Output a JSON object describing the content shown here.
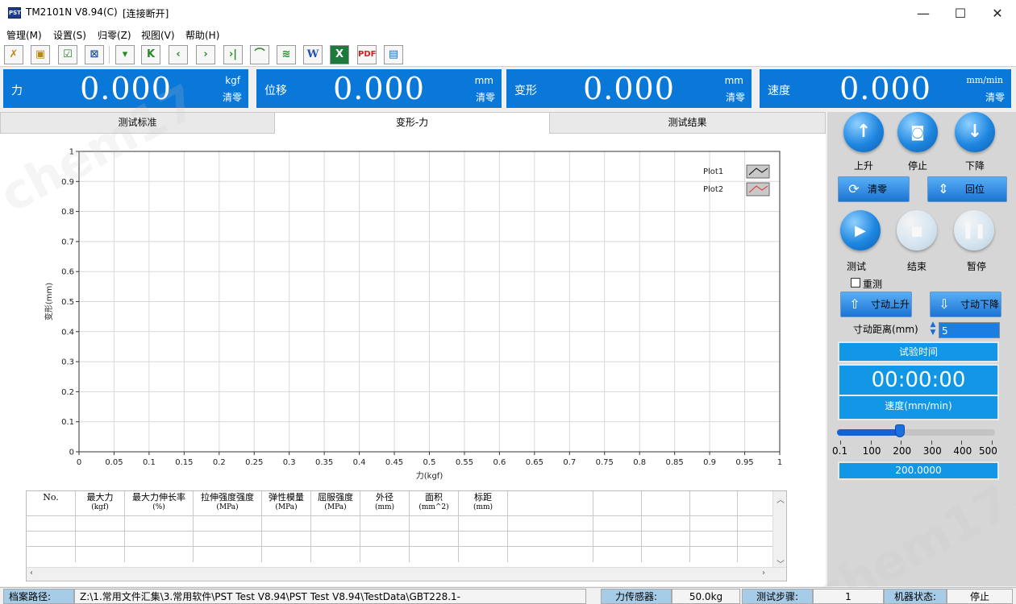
{
  "window": {
    "title": "TM2101N V8.94(C)",
    "status": "[连接断开]",
    "minimize": "—",
    "maximize": "☐",
    "close": "✕",
    "icon_text": "PST"
  },
  "menu": [
    "管理(M)",
    "设置(S)",
    "归零(Z)",
    "视图(V)",
    "帮助(H)"
  ],
  "toolbar": {
    "icons": [
      "tools-icon",
      "open-folder-icon",
      "report-icon",
      "exit-icon",
      "delete-icon",
      "first-icon",
      "prev-icon",
      "next-icon",
      "last-icon",
      "curve-icon",
      "multi-curve-icon",
      "word-export-icon",
      "excel-export-icon",
      "pdf-export-icon",
      "computer-icon"
    ],
    "glyphs": [
      "✗",
      "▣",
      "☑",
      "⊠",
      "▾",
      "K",
      "‹",
      "›",
      "›|",
      "⌒",
      "≋",
      "W",
      "X",
      "PDF",
      "▤"
    ]
  },
  "readouts": [
    {
      "label": "力",
      "value": "0.000",
      "unit": "kgf",
      "zero": "清零"
    },
    {
      "label": "位移",
      "value": "0.000",
      "unit": "mm",
      "zero": "清零"
    },
    {
      "label": "变形",
      "value": "0.000",
      "unit": "mm",
      "zero": "清零"
    },
    {
      "label": "速度",
      "value": "0.000",
      "unit": "mm/min",
      "zero": "清零"
    }
  ],
  "tabs": [
    "测试标准",
    "变形-力",
    "测试结果"
  ],
  "chart_data": {
    "type": "line",
    "xlabel": "力(kgf)",
    "ylabel": "变形(mm)",
    "xlim": [
      0,
      1
    ],
    "ylim": [
      0,
      1
    ],
    "x_ticks": [
      "0",
      "0.05",
      "0.1",
      "0.15",
      "0.2",
      "0.25",
      "0.3",
      "0.35",
      "0.4",
      "0.45",
      "0.5",
      "0.55",
      "0.6",
      "0.65",
      "0.7",
      "0.75",
      "0.8",
      "0.85",
      "0.9",
      "0.95",
      "1"
    ],
    "y_ticks": [
      "0",
      "0.1",
      "0.2",
      "0.3",
      "0.4",
      "0.5",
      "0.6",
      "0.7",
      "0.8",
      "0.9",
      "1"
    ],
    "grid": true,
    "legend": "top-right",
    "series": [
      {
        "name": "Plot1",
        "color": "#000000",
        "values": []
      },
      {
        "name": "Plot2",
        "color": "#e03030",
        "values": []
      }
    ]
  },
  "table": {
    "columns": [
      {
        "name": "No.",
        "unit": ""
      },
      {
        "name": "最大力",
        "unit": "(kgf)"
      },
      {
        "name": "最大力伸长率",
        "unit": "(%)"
      },
      {
        "name": "拉伸强度强度",
        "unit": "(MPa)"
      },
      {
        "name": "弹性模量",
        "unit": "(MPa)"
      },
      {
        "name": "屈服强度",
        "unit": "(MPa)"
      },
      {
        "name": "外径",
        "unit": "(mm)"
      },
      {
        "name": "面积",
        "unit": "(mm^2)"
      },
      {
        "name": "标距",
        "unit": "(mm)"
      },
      {
        "name": "",
        "unit": ""
      },
      {
        "name": "",
        "unit": ""
      },
      {
        "name": "",
        "unit": ""
      },
      {
        "name": "",
        "unit": ""
      }
    ],
    "rows": [
      [],
      [],
      []
    ]
  },
  "controls": {
    "up": "上升",
    "stop": "停止",
    "down": "下降",
    "zero": "清零",
    "return": "回位",
    "test": "测试",
    "end": "结束",
    "pause": "暂停",
    "retest": "重测",
    "jog_up": "寸动上升",
    "jog_down": "寸动下降",
    "jog_distance_label": "寸动距离(mm)",
    "jog_distance": "5",
    "test_time_label": "试验时间",
    "test_time": "00:00:00",
    "speed_label": "速度(mm/min)",
    "speed_scale": [
      "0.1",
      "100",
      "200",
      "300",
      "400",
      "500"
    ],
    "speed_slider_fraction": 0.4,
    "speed_value": "200.0000"
  },
  "status": {
    "path_label": "档案路径:",
    "path": "Z:\\1.常用文件汇集\\3.常用软件\\PST Test V8.94\\PST Test V8.94\\TestData\\GBT228.1-",
    "sensor_label": "力传感器:",
    "sensor": "50.0kg",
    "step_label": "测试步骤:",
    "step": "1",
    "machine_label": "机器状态:",
    "machine": "停止"
  }
}
